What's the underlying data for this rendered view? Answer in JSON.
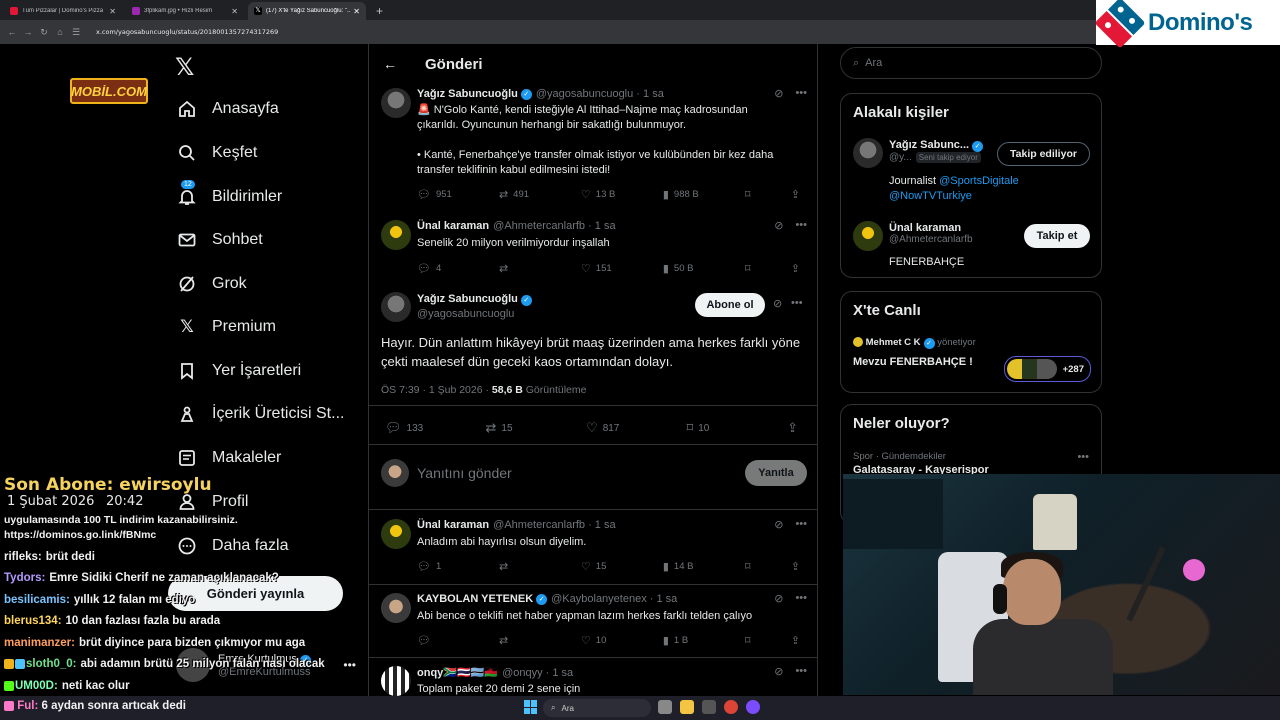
{
  "browser": {
    "tabs": [
      {
        "label": "Tüm Pizzalar | Domino's Pizza",
        "color": "#e31837"
      },
      {
        "label": "3fplikam.jpg • Hızlı Resim",
        "color": "#9c27b0"
      },
      {
        "label": "(17) X'te Yağız Sabuncuoğlu: \"...",
        "color": "#ffffff"
      }
    ],
    "new_tab": "+",
    "url": "x.com/yagosabuncuoglu/status/2018001357274317269"
  },
  "dominos": {
    "brand": "Domino's"
  },
  "overlay": {
    "mobil_logo": "MOBİL.COM",
    "sub_title": "Son Abone: ewirsoylu",
    "sub_date": "1 Şubat 2026",
    "sub_time": "20:42"
  },
  "nav": {
    "items": [
      {
        "label": "Anasayfa",
        "icon": "home-icon"
      },
      {
        "label": "Keşfet",
        "icon": "search-icon"
      },
      {
        "label": "Bildirimler",
        "icon": "bell-icon",
        "badge": "12"
      },
      {
        "label": "Sohbet",
        "icon": "mail-icon"
      },
      {
        "label": "Grok",
        "icon": "grok-icon"
      },
      {
        "label": "Premium",
        "icon": "x-icon"
      },
      {
        "label": "Yer İşaretleri",
        "icon": "bookmark-icon"
      },
      {
        "label": "İçerik Üreticisi St...",
        "icon": "creator-icon"
      },
      {
        "label": "Makaleler",
        "icon": "article-icon"
      },
      {
        "label": "Profil",
        "icon": "person-icon"
      },
      {
        "label": "Daha fazla",
        "icon": "more-icon"
      }
    ],
    "post_button": "Gönderi yayınla",
    "profile_name": "Emre Kurtulmuş",
    "profile_handle": "@EmreKurtulmuss"
  },
  "center": {
    "title": "Gönderi",
    "parent": {
      "name": "Yağız Sabuncuoğlu",
      "handle": "@yagosabuncuoglu · 1 sa",
      "line1": "🚨 N'Golo Kanté, kendi isteğiyle Al Ittihad–Najme maç kadrosundan",
      "line2": "çıkarıldı. Oyuncunun herhangi bir sakatlığı bulunmuyor.",
      "line3": "• Kanté, Fenerbahçe'ye transfer olmak istiyor ve kulübünden bir kez daha",
      "line4": "transfer teklifinin kabul edilmesini istedi!",
      "replies": "951",
      "reposts": "491",
      "likes": "13 B",
      "views": "988 B"
    },
    "reply1": {
      "name": "Ünal karaman",
      "handle": "@Ahmetercanlarfb · 1 sa",
      "text": "Senelik 20 milyon verilmiyordur inşallah",
      "replies": "4",
      "reposts": "",
      "likes": "151",
      "views": "50 B"
    },
    "main": {
      "name": "Yağız Sabuncuoğlu",
      "handle": "@yagosabuncuoglu",
      "subscribe": "Abone ol",
      "line1": "Hayır. Dün anlattım hikâyeyi brüt maaş üzerinden ama herkes farklı yöne",
      "line2": "çekti maalesef dün geceki kaos ortamından dolayı.",
      "time": "ÖS 7:39 · 1 Şub 2026 · ",
      "views": "58,6 B",
      "views_label": " Görüntüleme",
      "replies": "133",
      "reposts": "15",
      "likes": "817",
      "bookmarks": "10"
    },
    "reply_box": {
      "placeholder": "Yanıtını gönder",
      "button": "Yanıtla"
    },
    "replies": [
      {
        "name": "Ünal karaman",
        "handle": "@Ahmetercanlarfb · 1 sa",
        "text": "Anladım abi hayırlısı olsun diyelim.",
        "replies": "1",
        "reposts": "",
        "likes": "15",
        "views": "14 B"
      },
      {
        "name": "KAYBOLAN YETENEK",
        "handle": "@Kaybolanyetenex · 1 sa",
        "text": "Abi bence o teklifi net haber yapman lazım herkes farklı telden çalıyo",
        "replies": "",
        "reposts": "",
        "likes": "10",
        "views": "1 B"
      },
      {
        "name": "onqy🇿🇦🇹🇭🇧🇼🇲🇼",
        "handle": "@onqyy · 1 sa",
        "text": "Toplam paket 20 demi 2 sene için"
      }
    ]
  },
  "right": {
    "search_placeholder": "Ara",
    "related_title": "Alakalı kişiler",
    "person1": {
      "name": "Yağız Sabunc...",
      "handle": "@y...",
      "follows_you": "Seni takip ediyor",
      "button": "Takip ediliyor",
      "bio": "Journalist ",
      "link1": "@SportsDigitale",
      "link2": "@NowTVTurkiye"
    },
    "person2": {
      "name": "Ünal karaman",
      "handle": "@Ahmetercanlarfb",
      "button": "Takip et",
      "bio": "FENERBAHÇE"
    },
    "live_title": "X'te Canlı",
    "live_host": "Mehmet C K",
    "live_role": "yönetiyor",
    "live_topic": "Mevzu FENERBAHÇE !",
    "live_count": "+287",
    "trends_title": "Neler oluyor?",
    "trend_cat": "Spor · Gündemdekiler",
    "trend_name": "Galatasaray - Kayserispor"
  },
  "chat": [
    {
      "user": "",
      "text": "uygulamasında 100 TL indirim kazanabilirsiniz.",
      "color": "#f1f1f1"
    },
    {
      "user": "",
      "text": "https://dominos.go.link/fBNmc",
      "color": "#f1f1f1"
    },
    {
      "user": "rifleks:",
      "text": "brüt dedi",
      "color": "#f1f1f1"
    },
    {
      "user": "Tydors:",
      "text": "Emre Sidiki Cherif ne zaman açıklanacak?",
      "color": "#b49bff"
    },
    {
      "user": "besilicamis:",
      "text": "yıllık 12 falan mı ediyo",
      "color": "#7cc4ff"
    },
    {
      "user": "blerus134:",
      "text": "10 dan fazlası fazla bu arada",
      "color": "#ffd65a"
    },
    {
      "user": "manimanzer:",
      "text": "brüt diyince para bizden çıkmıyor mu aga",
      "color": "#ff9e5e"
    },
    {
      "user": "sloth0_0:",
      "text": "abi adamın brütü 25 milyon falan nası olacak",
      "color": "#6fe38a"
    },
    {
      "user": "UM00D:",
      "text": "neti kac olur",
      "color": "#7cffb2"
    },
    {
      "user": "Ful:",
      "text": "6 aydan sonra artıcak dedi",
      "color": "#ff7ac8"
    }
  ],
  "taskbar": {
    "search": "Ara"
  }
}
